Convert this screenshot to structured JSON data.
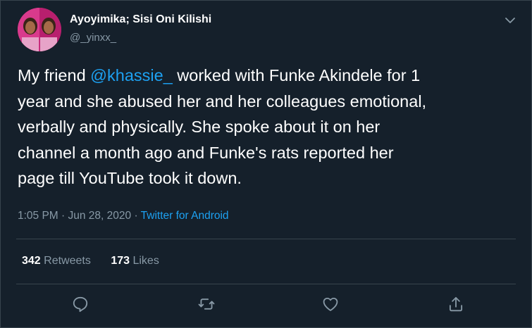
{
  "tweet": {
    "author": {
      "display_name": "Ayoyimika; Sisi Oni Kilishi",
      "handle": "@_yinxx_"
    },
    "body_lines": [
      {
        "before": "My friend ",
        "mention": "@khassie_",
        "after": " worked with Funke Akindele for 1"
      },
      {
        "text": "year and she abused her and her colleagues emotional,"
      },
      {
        "text": "verbally and physically. She spoke about it on her"
      },
      {
        "text": "channel a month ago and Funke's rats reported her"
      },
      {
        "text": "page till YouTube took it down."
      }
    ],
    "timestamp": "1:05 PM · Jun 28, 2020",
    "separator": " · ",
    "source": "Twitter for Android",
    "stats": {
      "retweets_count": "342",
      "retweets_label": "Retweets",
      "likes_count": "173",
      "likes_label": "Likes"
    }
  },
  "icons": {
    "menu": "chevron-down-icon",
    "reply": "reply-icon",
    "retweet": "retweet-icon",
    "like": "heart-icon",
    "share": "share-icon"
  },
  "colors": {
    "background": "#15202b",
    "text": "#ffffff",
    "secondary_text": "#8899a6",
    "link": "#1da1f2",
    "border": "#38444d"
  }
}
